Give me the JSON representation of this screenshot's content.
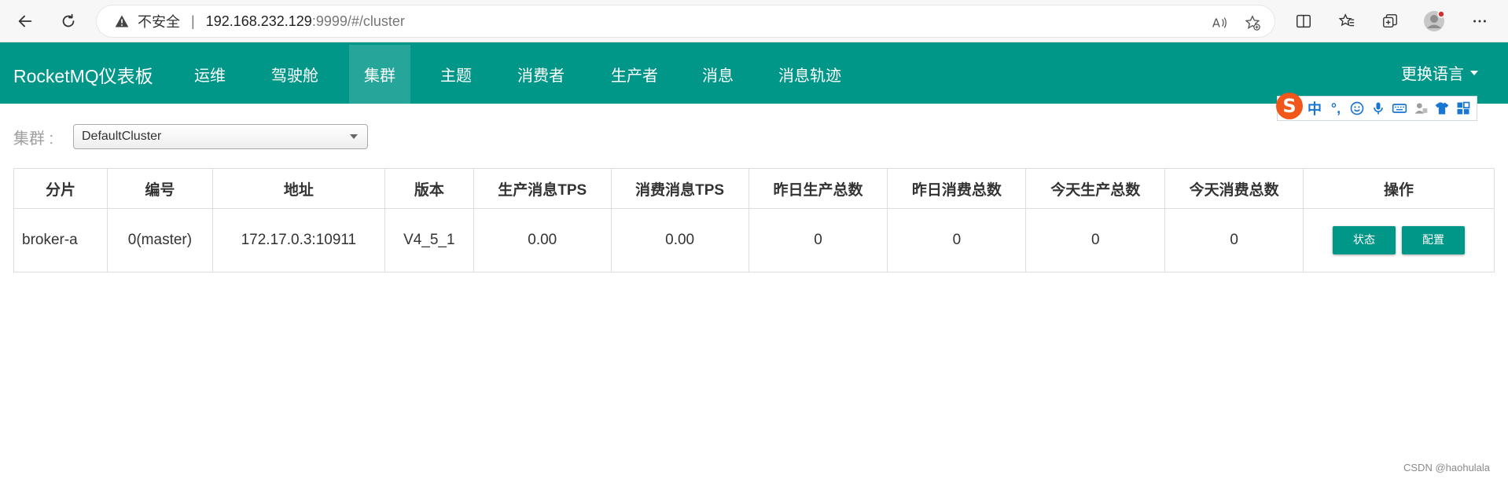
{
  "browser": {
    "security_text": "不安全",
    "url_host": "192.168.232.129",
    "url_path": ":9999/#/cluster"
  },
  "navbar": {
    "brand": "RocketMQ仪表板",
    "items": [
      {
        "label": "运维"
      },
      {
        "label": "驾驶舱"
      },
      {
        "label": "集群"
      },
      {
        "label": "主题"
      },
      {
        "label": "消费者"
      },
      {
        "label": "生产者"
      },
      {
        "label": "消息"
      },
      {
        "label": "消息轨迹"
      }
    ],
    "active": "集群",
    "language": "更换语言"
  },
  "ime": {
    "logo": "S",
    "mode": "中",
    "punct": "°,"
  },
  "cluster": {
    "label": "集群 :",
    "selected": "DefaultCluster"
  },
  "table": {
    "headers": [
      "分片",
      "编号",
      "地址",
      "版本",
      "生产消息TPS",
      "消费消息TPS",
      "昨日生产总数",
      "昨日消费总数",
      "今天生产总数",
      "今天消费总数",
      "操作"
    ],
    "rows": [
      {
        "broker": "broker-a",
        "id": "0(master)",
        "address": "172.17.0.3:10911",
        "version": "V4_5_1",
        "produce_tps": "0.00",
        "consume_tps": "0.00",
        "yesterday_produce": "0",
        "yesterday_consume": "0",
        "today_produce": "0",
        "today_consume": "0",
        "status_btn": "状态",
        "config_btn": "配置"
      }
    ]
  },
  "watermark": "CSDN @haohulala",
  "colors": {
    "primary": "#009688",
    "active_nav": "#26a69a"
  }
}
